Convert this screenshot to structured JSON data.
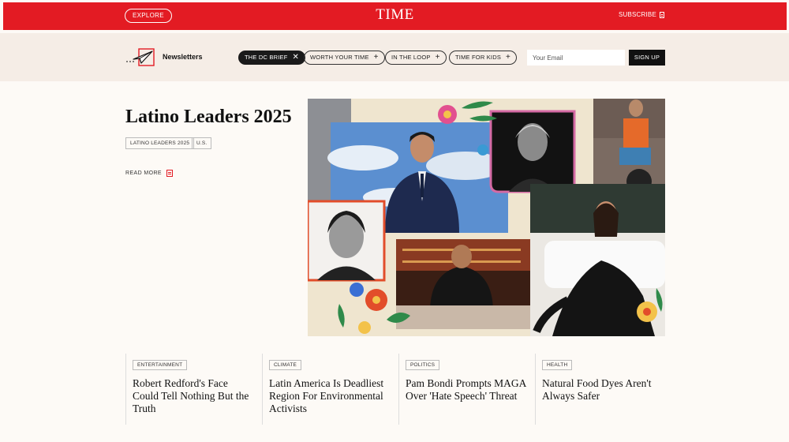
{
  "header": {
    "explore_label": "EXPLORE",
    "logo": "TIME",
    "subscribe_label": "SUBSCRIBE"
  },
  "newsletters": {
    "label": "Newsletters",
    "chips": [
      {
        "label": "THE DC BRIEF",
        "symbol": "✕",
        "active": true
      },
      {
        "label": "WORTH YOUR TIME",
        "symbol": "+",
        "active": false
      },
      {
        "label": "IN THE LOOP",
        "symbol": "+",
        "active": false
      },
      {
        "label": "TIME FOR KIDS",
        "symbol": "+",
        "active": false
      }
    ],
    "email_placeholder": "Your Email",
    "signup_label": "SIGN UP"
  },
  "hero": {
    "title": "Latino Leaders 2025",
    "tags": [
      "LATINO LEADERS 2025",
      "U.S."
    ],
    "read_more": "READ MORE"
  },
  "articles": [
    {
      "tag": "ENTERTAINMENT",
      "title": "Robert Redford's Face Could Tell Nothing But the Truth"
    },
    {
      "tag": "CLIMATE",
      "title": "Latin America Is Deadliest Region For Environmental Activists"
    },
    {
      "tag": "POLITICS",
      "title": "Pam Bondi Prompts MAGA Over 'Hate Speech' Threat"
    },
    {
      "tag": "HEALTH",
      "title": "Natural Food Dyes Aren't Always Safer"
    }
  ],
  "colors": {
    "brand_red": "#e31b23",
    "band_bg": "#f5ede6",
    "page_bg": "#fdfaf6"
  }
}
